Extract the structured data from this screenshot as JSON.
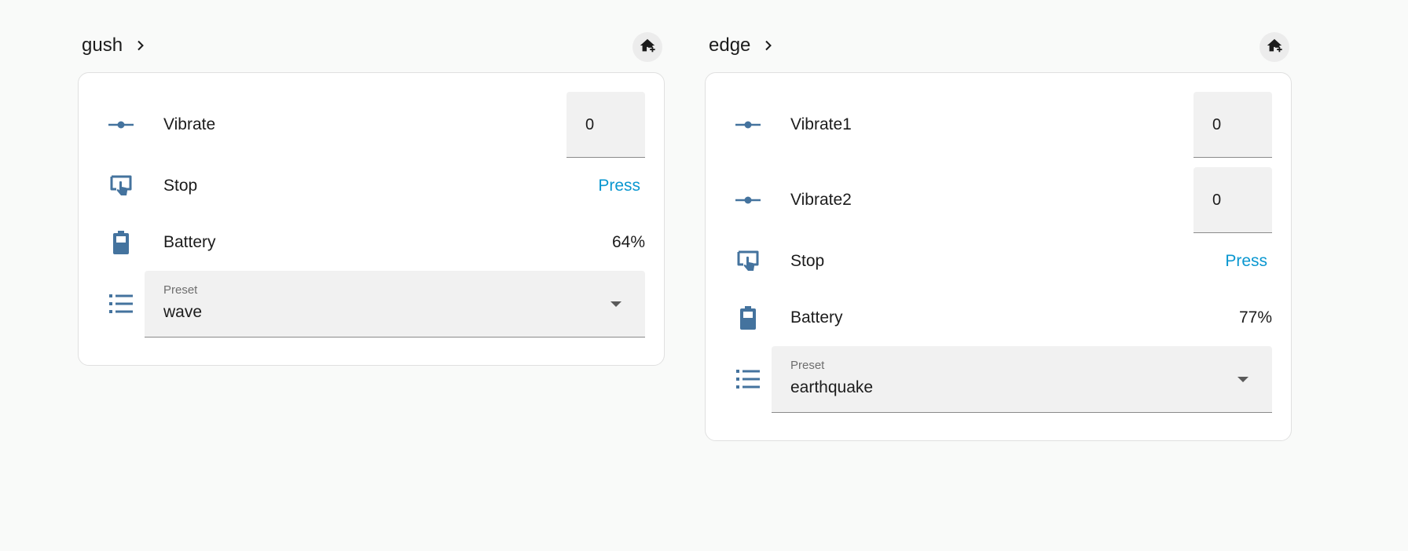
{
  "colors": {
    "background": "#f9faf9",
    "card": "#ffffff",
    "icon": "#44739e",
    "press": "#0a97d0",
    "field": "#f1f1f1"
  },
  "devices": [
    {
      "name": "gush",
      "rows": [
        {
          "kind": "number",
          "icon": "slider-icon",
          "label": "Vibrate",
          "value": "0"
        },
        {
          "kind": "button",
          "icon": "gesture-tap-button-icon",
          "label": "Stop",
          "action": "Press"
        },
        {
          "kind": "sensor",
          "icon": "battery-icon",
          "label": "Battery",
          "value": "64%",
          "level": 0.64
        }
      ],
      "select": {
        "icon": "format-list-icon",
        "label": "Preset",
        "value": "wave"
      }
    },
    {
      "name": "edge",
      "rows": [
        {
          "kind": "number",
          "icon": "slider-icon",
          "label": "Vibrate1",
          "value": "0"
        },
        {
          "kind": "number",
          "icon": "slider-icon",
          "label": "Vibrate2",
          "value": "0"
        },
        {
          "kind": "button",
          "icon": "gesture-tap-button-icon",
          "label": "Stop",
          "action": "Press"
        },
        {
          "kind": "sensor",
          "icon": "battery-icon",
          "label": "Battery",
          "value": "77%",
          "level": 0.77
        }
      ],
      "select": {
        "icon": "format-list-icon",
        "label": "Preset",
        "value": "earthquake"
      }
    }
  ]
}
